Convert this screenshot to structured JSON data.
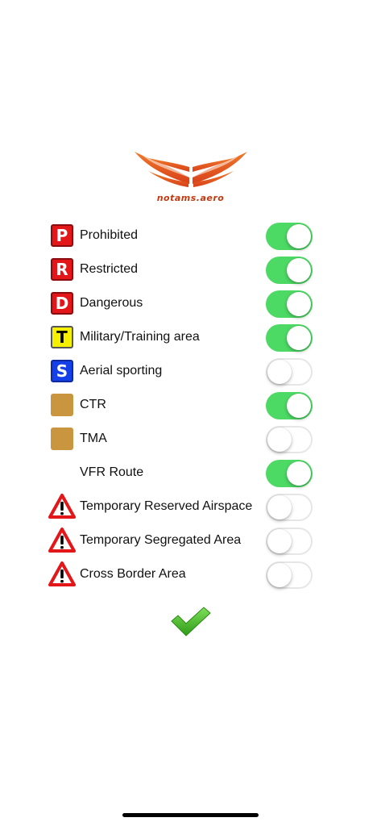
{
  "logo": {
    "brand_text": "notams.aero"
  },
  "filters": [
    {
      "label": "Prohibited",
      "icon": "letter-badge",
      "icon_letter": "P",
      "icon_color": "#e3161a",
      "enabled": true
    },
    {
      "label": "Restricted",
      "icon": "letter-badge",
      "icon_letter": "R",
      "icon_color": "#e3161a",
      "enabled": true
    },
    {
      "label": "Dangerous",
      "icon": "letter-badge",
      "icon_letter": "D",
      "icon_color": "#e3161a",
      "enabled": true
    },
    {
      "label": "Military/Training area",
      "icon": "letter-badge",
      "icon_letter": "T",
      "icon_color": "#f5f000",
      "enabled": true
    },
    {
      "label": "Aerial sporting",
      "icon": "letter-badge",
      "icon_letter": "S",
      "icon_color": "#1540e8",
      "enabled": false
    },
    {
      "label": "CTR",
      "icon": "square-badge",
      "icon_color": "#c9963f",
      "enabled": true
    },
    {
      "label": "TMA",
      "icon": "square-badge",
      "icon_color": "#c9963f",
      "enabled": false
    },
    {
      "label": "VFR Route",
      "icon": "none",
      "enabled": true
    },
    {
      "label": "Temporary Reserved Airspace",
      "icon": "warning-triangle-icon",
      "icon_color": "#e3161a",
      "enabled": false
    },
    {
      "label": "Temporary Segregated Area",
      "icon": "warning-triangle-icon",
      "icon_color": "#e3161a",
      "enabled": false
    },
    {
      "label": "Cross Border Area",
      "icon": "warning-triangle-icon",
      "icon_color": "#e3161a",
      "enabled": false
    }
  ],
  "colors": {
    "toggle_on": "#4cd964",
    "toggle_off_border": "#e6e6e6",
    "confirm_check": "#3cb521",
    "brand_orange": "#e4521f"
  },
  "confirm": {
    "icon": "checkmark-icon"
  }
}
